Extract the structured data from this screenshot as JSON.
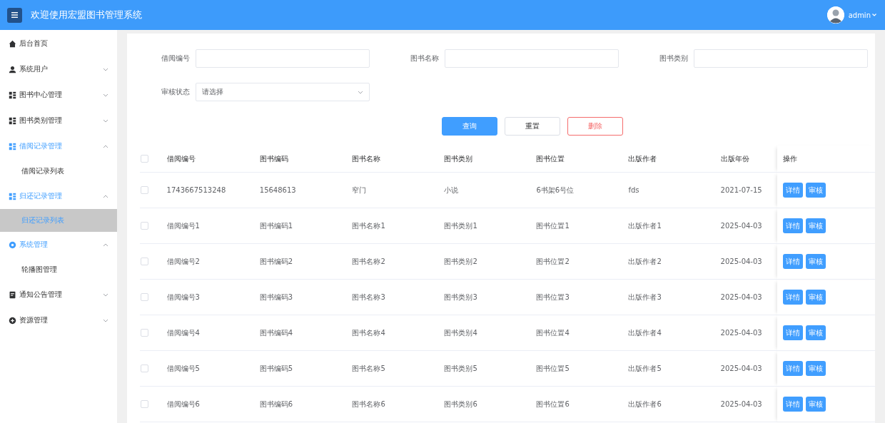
{
  "header": {
    "title": "欢迎使用宏盟图书管理系统",
    "user": "admin"
  },
  "sidebar": {
    "items": [
      {
        "label": "后台首页",
        "selected": false
      },
      {
        "label": "系统用户",
        "expanded": false,
        "selected": false
      },
      {
        "label": "图书中心管理",
        "expanded": false,
        "selected": false
      },
      {
        "label": "图书类别管理",
        "expanded": false,
        "selected": false
      },
      {
        "label": "借阅记录管理",
        "expanded": true,
        "selected": true,
        "children": [
          {
            "label": "借阅记录列表",
            "selected": false
          }
        ]
      },
      {
        "label": "归还记录管理",
        "expanded": true,
        "selected": true,
        "children": [
          {
            "label": "归还记录列表",
            "selected": true
          }
        ]
      },
      {
        "label": "系统管理",
        "expanded": true,
        "selected": true,
        "children": [
          {
            "label": "轮播图管理",
            "selected": false
          }
        ]
      },
      {
        "label": "通知公告管理",
        "expanded": false,
        "selected": false
      },
      {
        "label": "资源管理",
        "expanded": false,
        "selected": false
      }
    ]
  },
  "search": {
    "fields": [
      {
        "kind": "text",
        "label": "借阅编号"
      },
      {
        "kind": "text",
        "label": "图书名称"
      },
      {
        "kind": "text",
        "label": "图书类别"
      },
      {
        "kind": "select",
        "label": "审核状态",
        "placeholder": "请选择"
      }
    ],
    "buttons": [
      {
        "kind": "primary",
        "label": "查询"
      },
      {
        "kind": "default",
        "label": "重置"
      },
      {
        "kind": "danger",
        "label": "删除"
      }
    ]
  },
  "table": {
    "all_checked": false,
    "columns": [
      "借阅编号",
      "图书编码",
      "图书名称",
      "图书类别",
      "图书位置",
      "出版作者",
      "出版年份",
      "操作"
    ],
    "rows": [
      {
        "checked": false,
        "cells": [
          "1743667513248",
          "15648613",
          "窄门",
          "小说",
          "6书架6号位",
          "fds",
          "2021-07-15"
        ],
        "actions": [
          "详情",
          "审核"
        ]
      },
      {
        "checked": false,
        "cells": [
          "借阅编号1",
          "图书编码1",
          "图书名称1",
          "图书类别1",
          "图书位置1",
          "出版作者1",
          "2025-04-03"
        ],
        "actions": [
          "详情",
          "审核"
        ]
      },
      {
        "checked": false,
        "cells": [
          "借阅编号2",
          "图书编码2",
          "图书名称2",
          "图书类别2",
          "图书位置2",
          "出版作者2",
          "2025-04-03"
        ],
        "actions": [
          "详情",
          "审核"
        ]
      },
      {
        "checked": false,
        "cells": [
          "借阅编号3",
          "图书编码3",
          "图书名称3",
          "图书类别3",
          "图书位置3",
          "出版作者3",
          "2025-04-03"
        ],
        "actions": [
          "详情",
          "审核"
        ]
      },
      {
        "checked": false,
        "cells": [
          "借阅编号4",
          "图书编码4",
          "图书名称4",
          "图书类别4",
          "图书位置4",
          "出版作者4",
          "2025-04-03"
        ],
        "actions": [
          "详情",
          "审核"
        ]
      },
      {
        "checked": false,
        "cells": [
          "借阅编号5",
          "图书编码5",
          "图书名称5",
          "图书类别5",
          "图书位置5",
          "出版作者5",
          "2025-04-03"
        ],
        "actions": [
          "详情",
          "审核"
        ]
      },
      {
        "checked": false,
        "cells": [
          "借阅编号6",
          "图书编码6",
          "图书名称6",
          "图书类别6",
          "图书位置6",
          "出版作者6",
          "2025-04-03"
        ],
        "actions": [
          "详情",
          "审核"
        ]
      }
    ]
  }
}
